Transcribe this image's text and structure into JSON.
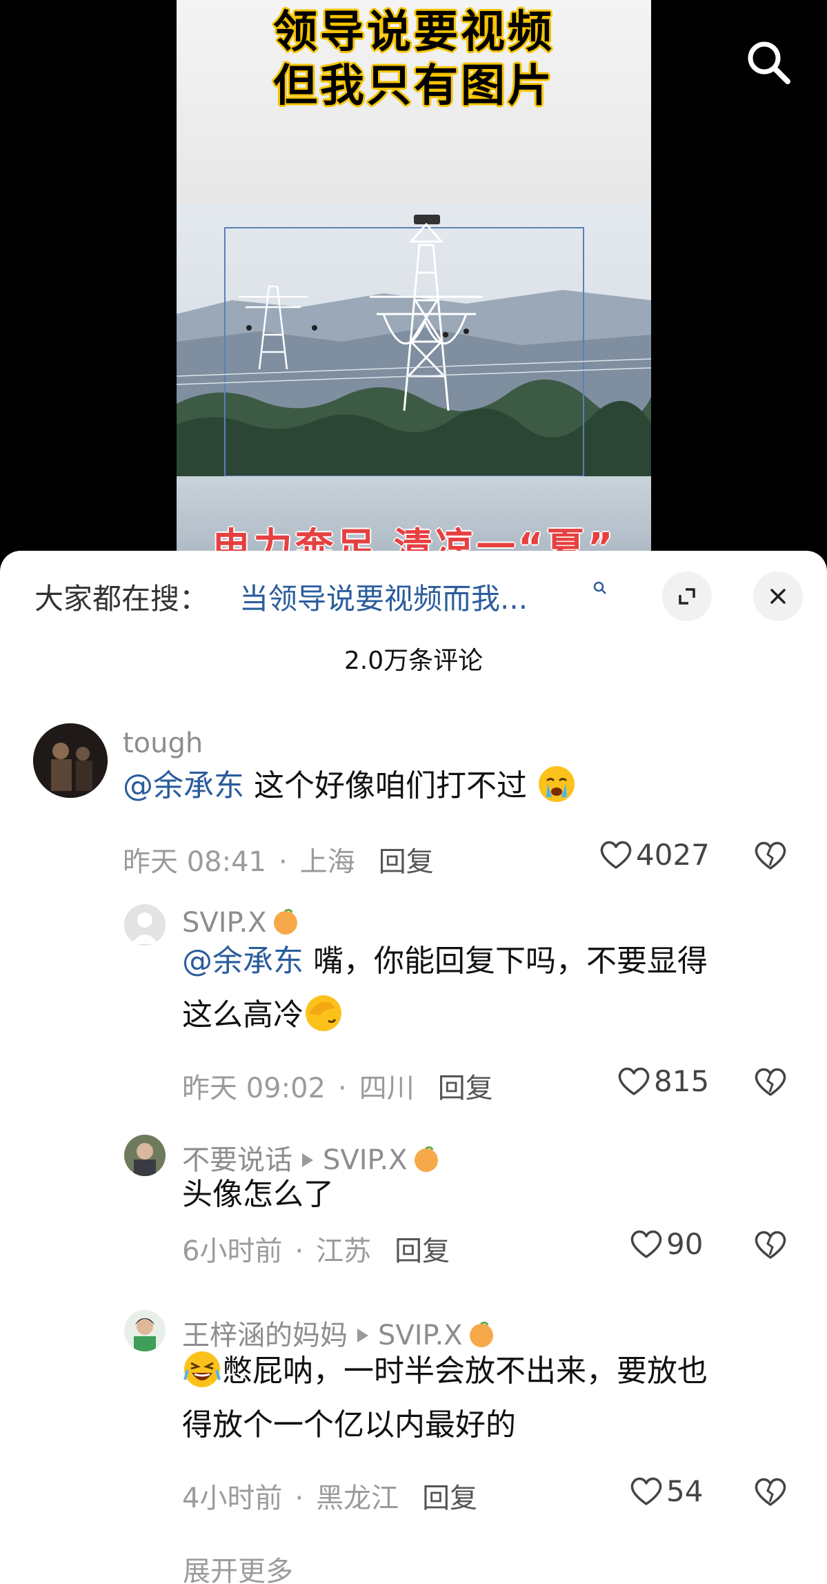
{
  "video": {
    "caption_line1": "领导说要视频",
    "caption_line2": "但我只有图片",
    "overlay_text": "电力奔足 清凉一“夏”",
    "search_icon": "search-icon"
  },
  "sheet": {
    "search_prefix": "大家都在搜：",
    "search_query": "当领导说要视频而我...",
    "expand_icon": "expand-icon",
    "close_icon": "close-icon",
    "comment_count": "2.0万条评论"
  },
  "comments": [
    {
      "user": "tough",
      "mention": "@余承东",
      "text": " 这个好像咱们打不过",
      "emoji": "crying-emoji",
      "time": "昨天 08:41",
      "location": "上海",
      "reply": "回复",
      "likes": "4027"
    },
    {
      "user": "SVIP.X",
      "badge": "orange-badge",
      "mention": "@余承东",
      "text": " 嘴，你能回复下吗，不要显得",
      "text2": "这么高冷",
      "emoji": "facepalm-emoji",
      "time": "昨天 09:02",
      "location": "四川",
      "reply": "回复",
      "likes": "815"
    },
    {
      "user": "不要说话",
      "reply_to": "SVIP.X",
      "text": "头像怎么了",
      "time": "6小时前",
      "location": "江苏",
      "reply": "回复",
      "likes": "90"
    },
    {
      "user": "王梓涵的妈妈",
      "reply_to": "SVIP.X",
      "text": "憋屁呐，一时半会放不出来，要放也",
      "text2": "得放个一个亿以内最好的",
      "emoji": "laughing-crying-emoji",
      "time": "4小时前",
      "location": "黑龙江",
      "reply": "回复",
      "likes": "54"
    }
  ],
  "more": "展开更多",
  "colors": {
    "mention": "#2a5c9c",
    "caption_stroke": "#f5c400"
  }
}
